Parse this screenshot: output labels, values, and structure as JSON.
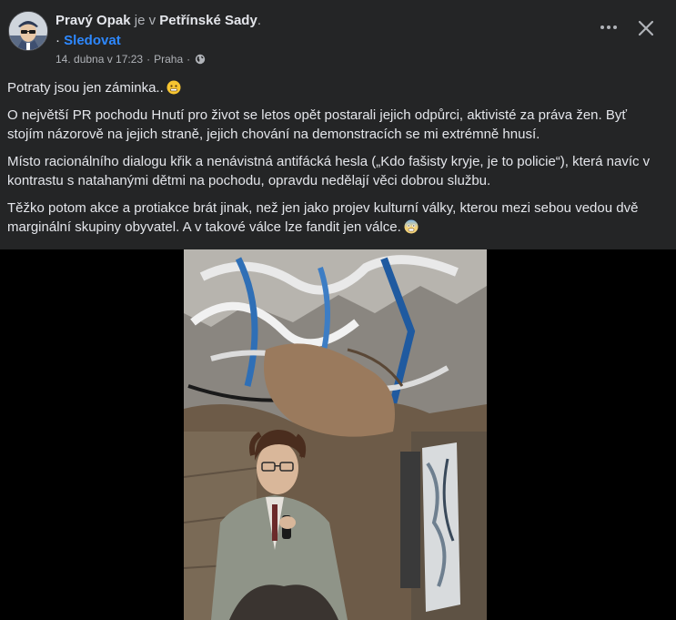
{
  "post": {
    "author": "Pravý Opak",
    "connector": "je v",
    "place": "Petřínské Sady",
    "place_suffix": ".",
    "follow_dot": "·",
    "follow_label": "Sledovat",
    "date": "14. dubna v 17:23",
    "meta_sep": "·",
    "location": "Praha",
    "privacy_icon": "globe-icon",
    "paragraphs": [
      "Potraty jsou jen záminka..",
      "O největší PR pochodu Hnutí pro život se letos opět postarali jejich odpůrci, aktivisté za práva žen. Byť stojím názorově na jejich straně, jejich chování na demonstracích se mi extrémně hnusí.",
      "Místo racionálního dialogu křik a nenávistná antifácká hesla („Kdo fašisty kryje, je to policie“), která navíc v kontrastu s natahanými dětmi na pochodu, opravdu nedělají věci dobrou službu.",
      "Těžko potom akce a protiakce brát jinak, než jen jako projev kulturní války, kterou mezi sebou vedou dvě marginální skupiny obyvatel. A v takové válce lze fandit jen válce."
    ],
    "emoji_1": "smile-emoji",
    "emoji_2": "fear-emoji"
  },
  "controls": {
    "more_icon": "more-icon",
    "close_icon": "close-icon"
  },
  "colors": {
    "background": "#242526",
    "text": "#e4e6eb",
    "secondary": "#b0b3b8",
    "link": "#2d88ff",
    "media_bg": "#000000"
  }
}
